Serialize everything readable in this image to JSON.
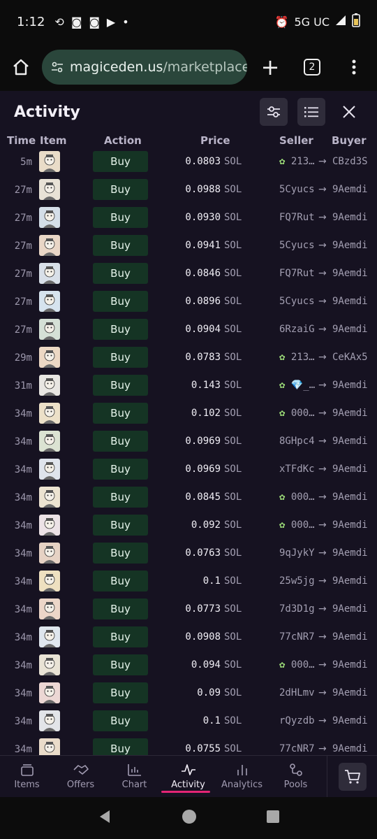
{
  "status": {
    "time": "1:12",
    "network": "5G UC"
  },
  "browser": {
    "url_host": "magiceden.us",
    "url_path": "/marketplace",
    "tab_count": "2"
  },
  "activity": {
    "title": "Activity",
    "headers": {
      "time": "Time",
      "item": "Item",
      "action": "Action",
      "price": "Price",
      "seller": "Seller",
      "buyer": "Buyer"
    },
    "rows": [
      {
        "time": "5m",
        "action": "Buy",
        "price": "0.0803",
        "unit": "SOL",
        "seller_badge": "✿",
        "seller": "213…",
        "buyer": "CBzd3S",
        "avatar_color": "#e9dcc8"
      },
      {
        "time": "27m",
        "action": "Buy",
        "price": "0.0988",
        "unit": "SOL",
        "seller_badge": "",
        "seller": "5Cyucs",
        "buyer": "9Aemdi",
        "avatar_color": "#e8e2d6"
      },
      {
        "time": "27m",
        "action": "Buy",
        "price": "0.0930",
        "unit": "SOL",
        "seller_badge": "",
        "seller": "FQ7Rut",
        "buyer": "9Aemdi",
        "avatar_color": "#d4dee8"
      },
      {
        "time": "27m",
        "action": "Buy",
        "price": "0.0941",
        "unit": "SOL",
        "seller_badge": "",
        "seller": "5Cyucs",
        "buyer": "9Aemdi",
        "avatar_color": "#e9d6c6"
      },
      {
        "time": "27m",
        "action": "Buy",
        "price": "0.0846",
        "unit": "SOL",
        "seller_badge": "",
        "seller": "FQ7Rut",
        "buyer": "9Aemdi",
        "avatar_color": "#d8dfe8"
      },
      {
        "time": "27m",
        "action": "Buy",
        "price": "0.0896",
        "unit": "SOL",
        "seller_badge": "",
        "seller": "5Cyucs",
        "buyer": "9Aemdi",
        "avatar_color": "#d6e3ee"
      },
      {
        "time": "27m",
        "action": "Buy",
        "price": "0.0904",
        "unit": "SOL",
        "seller_badge": "",
        "seller": "6RzaiG",
        "buyer": "9Aemdi",
        "avatar_color": "#d5e0d6"
      },
      {
        "time": "29m",
        "action": "Buy",
        "price": "0.0783",
        "unit": "SOL",
        "seller_badge": "✿",
        "seller": "213…",
        "buyer": "CeKAx5",
        "avatar_color": "#ecd8c4"
      },
      {
        "time": "31m",
        "action": "Buy",
        "price": "0.143",
        "unit": "SOL",
        "seller_badge": "✿",
        "seller": "💎_…",
        "buyer": "9Aemdi",
        "avatar_color": "#e8e6e2"
      },
      {
        "time": "34m",
        "action": "Buy",
        "price": "0.102",
        "unit": "SOL",
        "seller_badge": "✿",
        "seller": "000…",
        "buyer": "9Aemdi",
        "avatar_color": "#ece0c8"
      },
      {
        "time": "34m",
        "action": "Buy",
        "price": "0.0969",
        "unit": "SOL",
        "seller_badge": "",
        "seller": "8GHpc4",
        "buyer": "9Aemdi",
        "avatar_color": "#dbe3d2"
      },
      {
        "time": "34m",
        "action": "Buy",
        "price": "0.0969",
        "unit": "SOL",
        "seller_badge": "",
        "seller": "xTFdKc",
        "buyer": "9Aemdi",
        "avatar_color": "#dfe4ec"
      },
      {
        "time": "34m",
        "action": "Buy",
        "price": "0.0845",
        "unit": "SOL",
        "seller_badge": "✿",
        "seller": "000…",
        "buyer": "9Aemdi",
        "avatar_color": "#ece3d1"
      },
      {
        "time": "34m",
        "action": "Buy",
        "price": "0.092",
        "unit": "SOL",
        "seller_badge": "✿",
        "seller": "000…",
        "buyer": "9Aemdi",
        "avatar_color": "#ece2e6"
      },
      {
        "time": "34m",
        "action": "Buy",
        "price": "0.0763",
        "unit": "SOL",
        "seller_badge": "",
        "seller": "9qJykY",
        "buyer": "9Aemdi",
        "avatar_color": "#e6d2c4"
      },
      {
        "time": "34m",
        "action": "Buy",
        "price": "0.1",
        "unit": "SOL",
        "seller_badge": "",
        "seller": "25w5jg",
        "buyer": "9Aemdi",
        "avatar_color": "#eee0c0"
      },
      {
        "time": "34m",
        "action": "Buy",
        "price": "0.0773",
        "unit": "SOL",
        "seller_badge": "",
        "seller": "7d3D1g",
        "buyer": "9Aemdi",
        "avatar_color": "#ecd6c8"
      },
      {
        "time": "34m",
        "action": "Buy",
        "price": "0.0908",
        "unit": "SOL",
        "seller_badge": "",
        "seller": "77cNR7",
        "buyer": "9Aemdi",
        "avatar_color": "#dfe6ee"
      },
      {
        "time": "34m",
        "action": "Buy",
        "price": "0.094",
        "unit": "SOL",
        "seller_badge": "✿",
        "seller": "000…",
        "buyer": "9Aemdi",
        "avatar_color": "#e9e3d5"
      },
      {
        "time": "34m",
        "action": "Buy",
        "price": "0.09",
        "unit": "SOL",
        "seller_badge": "",
        "seller": "2dHLmv",
        "buyer": "9Aemdi",
        "avatar_color": "#ecd7d4"
      },
      {
        "time": "34m",
        "action": "Buy",
        "price": "0.1",
        "unit": "SOL",
        "seller_badge": "",
        "seller": "rQyzdb",
        "buyer": "9Aemdi",
        "avatar_color": "#e2e4e8"
      },
      {
        "time": "34m",
        "action": "Buy",
        "price": "0.0755",
        "unit": "SOL",
        "seller_badge": "",
        "seller": "77cNR7",
        "buyer": "9Aemdi",
        "avatar_color": "#eadcca"
      }
    ]
  },
  "bottom_nav": [
    {
      "label": "Items",
      "icon": "stack-icon"
    },
    {
      "label": "Offers",
      "icon": "handshake-icon"
    },
    {
      "label": "Chart",
      "icon": "bar-chart-icon"
    },
    {
      "label": "Activity",
      "icon": "pulse-icon",
      "active": true
    },
    {
      "label": "Analytics",
      "icon": "analytics-icon"
    },
    {
      "label": "Pools",
      "icon": "pools-icon"
    }
  ],
  "colors": {
    "accent": "#e42575",
    "buy_button": "#153424",
    "url_bar": "#2a463b"
  }
}
